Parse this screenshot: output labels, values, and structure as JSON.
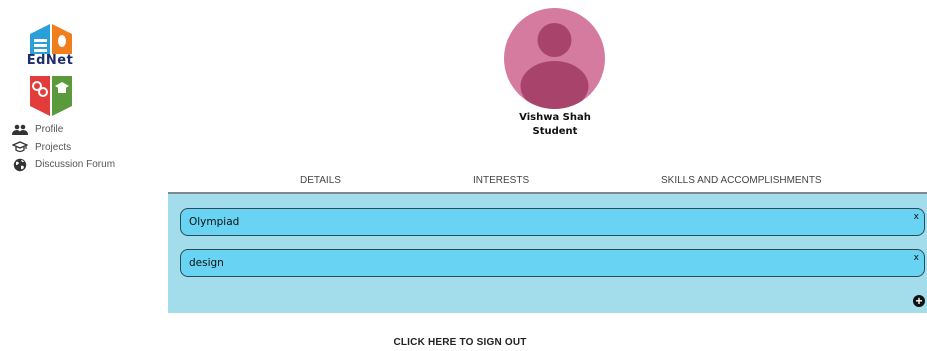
{
  "brand": {
    "logo_text": "EdNet",
    "icon": "ednet-logo-icon",
    "colors": {
      "blue": "#2a9fd8",
      "orange": "#f07d1e",
      "red": "#e23d3a",
      "green": "#5a9a3c",
      "navy": "#1f2f6b"
    }
  },
  "sidebar": {
    "items": [
      {
        "label": "Profile",
        "icon": "people-icon"
      },
      {
        "label": "Projects",
        "icon": "graduation-cap-icon"
      },
      {
        "label": "Discussion Forum",
        "icon": "globe-icon"
      }
    ]
  },
  "profile": {
    "name": "Vishwa Shah",
    "role": "Student",
    "avatar_icon": "user-avatar-icon",
    "avatar_color": "#d47b9f"
  },
  "tabs": [
    {
      "label": "DETAILS"
    },
    {
      "label": "INTERESTS"
    },
    {
      "label": "SKILLS AND ACCOMPLISHMENTS"
    }
  ],
  "skills": {
    "items": [
      {
        "label": "Olympiad",
        "remove_label": "x"
      },
      {
        "label": "design",
        "remove_label": "x"
      }
    ],
    "add_icon": "add-circle-icon",
    "panel_color": "#a3dcea",
    "chip_color": "#68d3f3"
  },
  "signout": {
    "label": "CLICK HERE TO SIGN OUT"
  }
}
